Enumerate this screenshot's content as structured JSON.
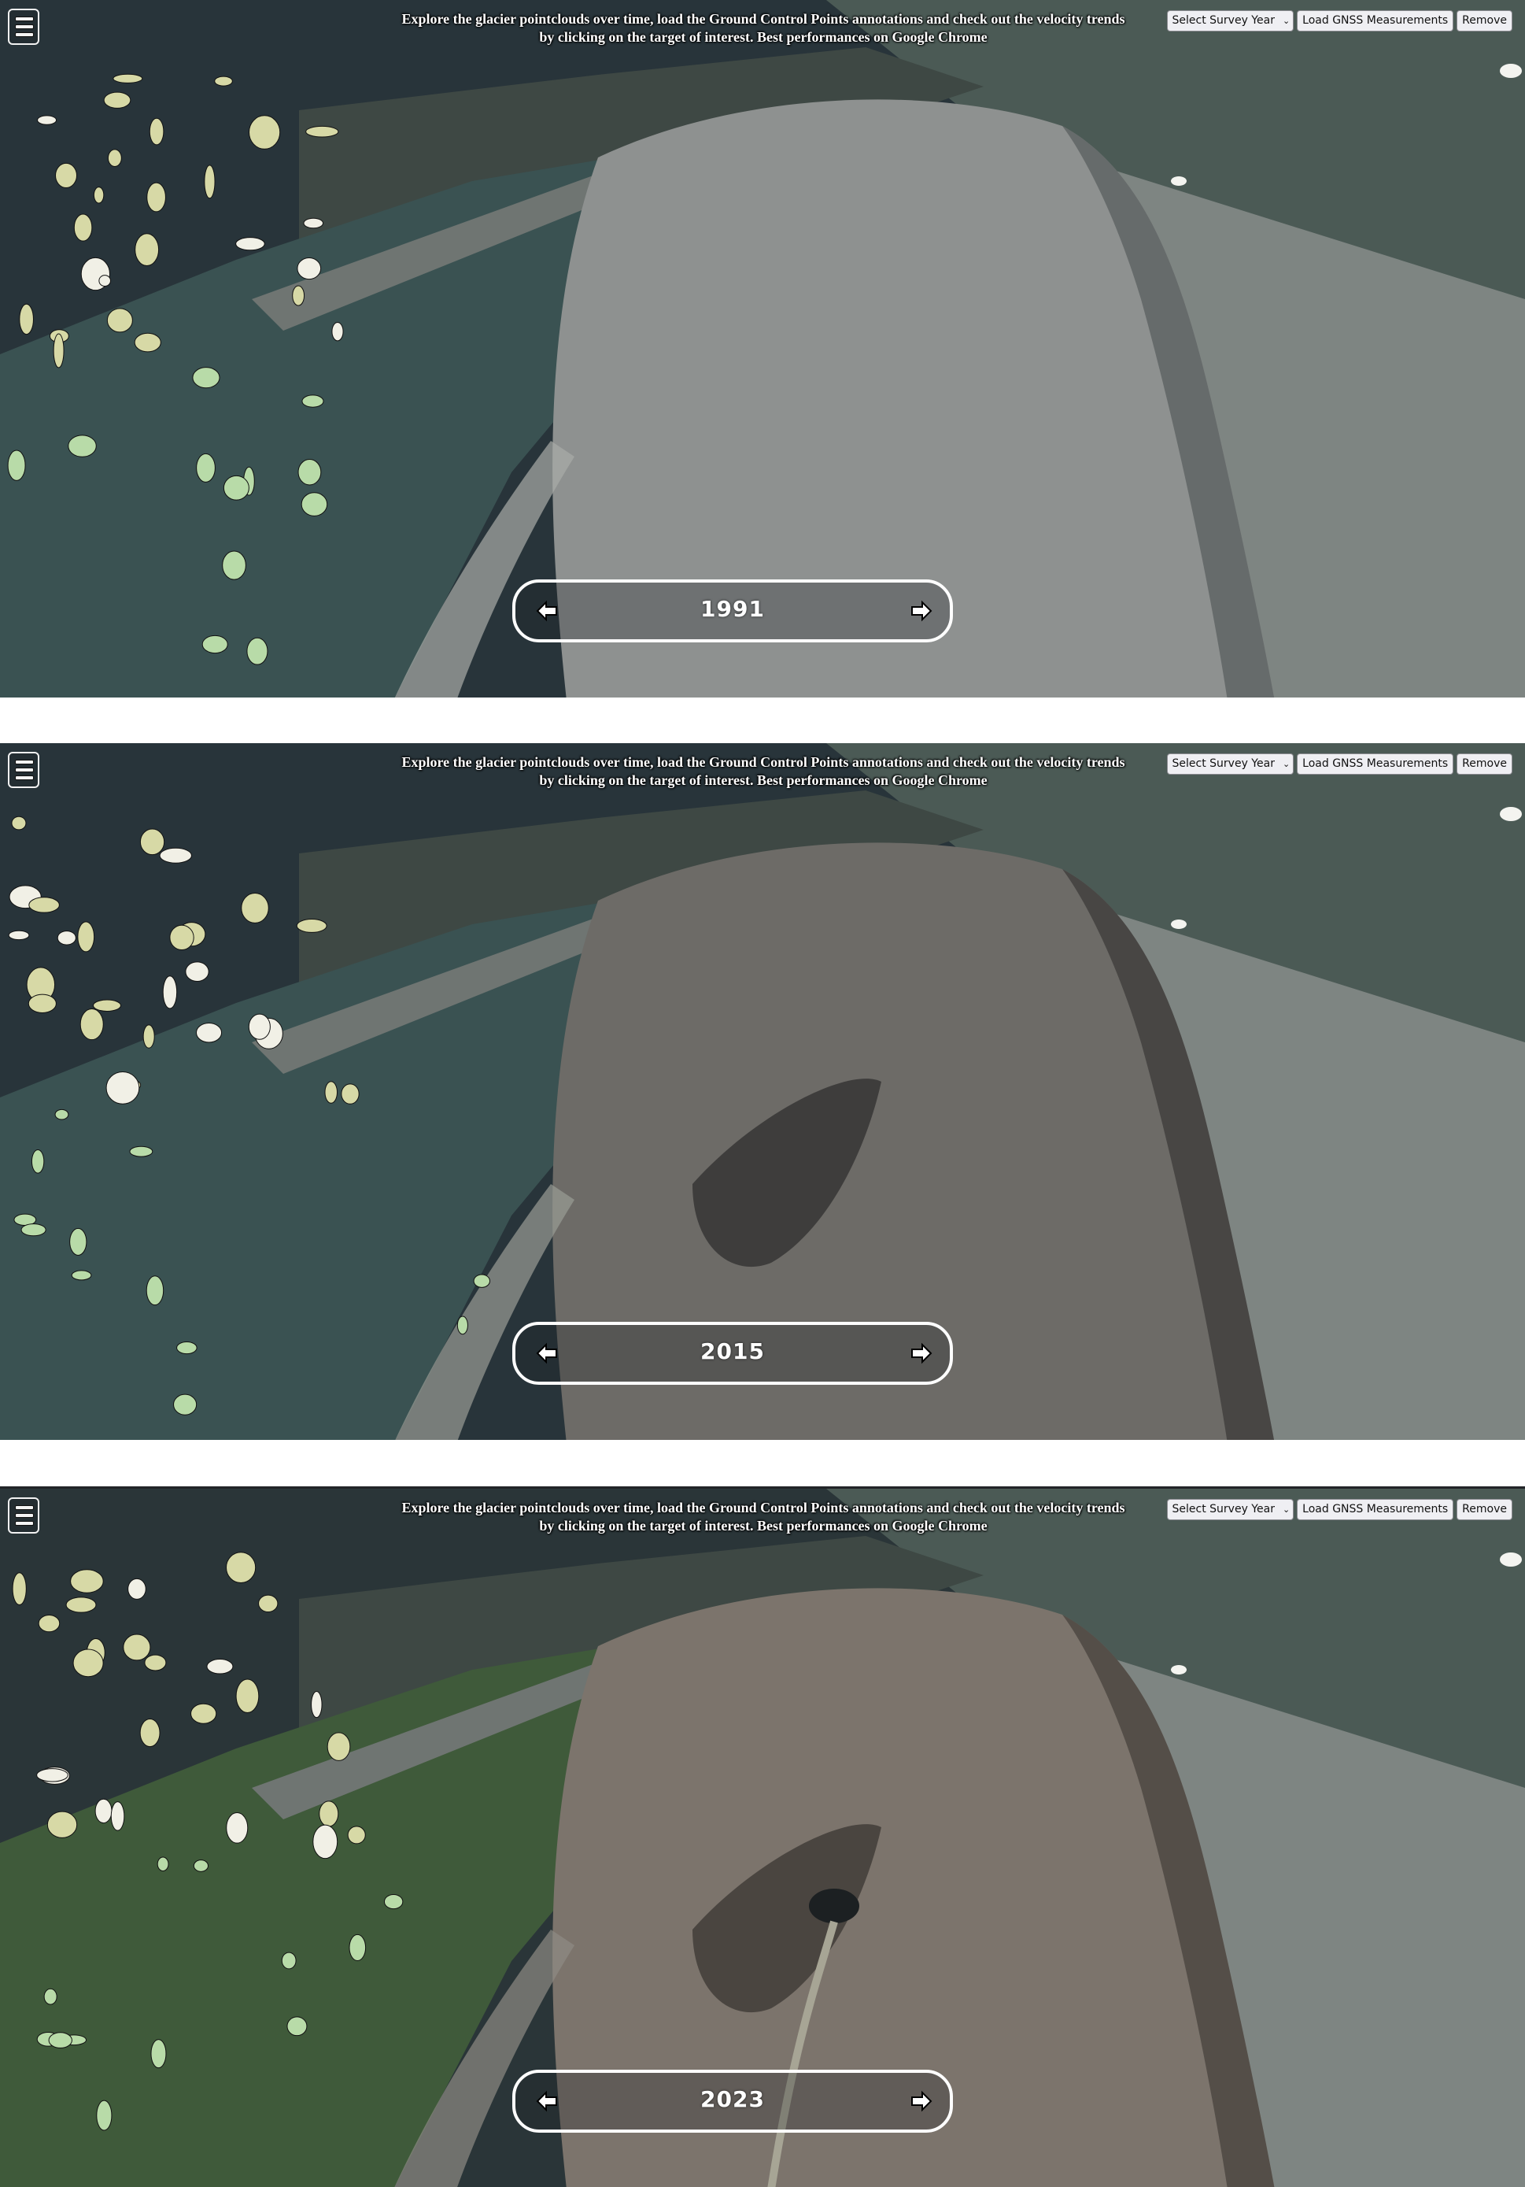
{
  "header": {
    "info_text": "Explore the glacier pointclouds over time, load the Ground Control Points annotations and check out the velocity trends by clicking on the target of interest. Best performances on Google Chrome",
    "menu_icon": "hamburger-menu-icon",
    "survey_select": {
      "selected": "Select Survey Year"
    },
    "load_button": "Load GNSS Measurements",
    "remove_button": "Remove"
  },
  "navigation": {
    "prev_icon": "arrow-left-icon",
    "next_icon": "arrow-right-icon"
  },
  "panels": [
    {
      "year": "1991",
      "palette": {
        "glacier": "#8e9190",
        "glacier_dark": "#5d6262",
        "forest": "#3a5252",
        "slope": "#28343a",
        "lichen": "#d7d9a6",
        "debris": "#a9ada8"
      }
    },
    {
      "year": "2015",
      "palette": {
        "glacier": "#6d6b67",
        "glacier_dark": "#3e3d3c",
        "forest": "#3a5252",
        "slope": "#28343a",
        "lichen": "#d7d9a6",
        "debris": "#9a9c96"
      }
    },
    {
      "year": "2023",
      "palette": {
        "glacier": "#7c746c",
        "glacier_dark": "#4a4540",
        "forest": "#3f5a3a",
        "slope": "#2a3538",
        "lichen": "#d7d9a6",
        "debris": "#8e8c84"
      }
    }
  ]
}
